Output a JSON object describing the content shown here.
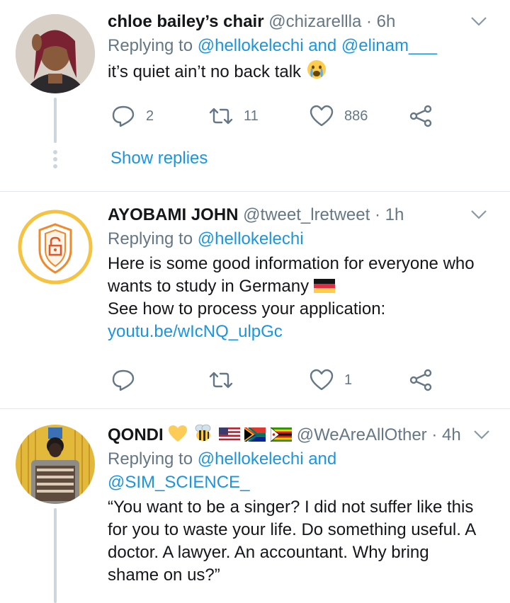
{
  "tweets": [
    {
      "name": "chloe bailey’s chair",
      "handle": "@chizarellla",
      "sep": "·",
      "time": "6h",
      "replying_prefix": "Replying to ",
      "replying_users_1": "@hellokelechi and @elinam___",
      "text_1": "it’s quiet ain’t no back talk",
      "counts": {
        "replies": "2",
        "retweets": "11",
        "likes": "886"
      },
      "show_replies": "Show replies"
    },
    {
      "name": "AYOBAMI JOHN",
      "handle": "@tweet_lretweet",
      "sep": "·",
      "time": "1h",
      "replying_prefix": "Replying to ",
      "replying_users_1": "@hellokelechi",
      "text_1": "Here is some good information for everyone who",
      "text_2": "wants to study in Germany",
      "text_3": "See how to process your application:",
      "link": "youtu.be/wIcNQ_ulpGc",
      "counts": {
        "replies": "",
        "retweets": "",
        "likes": "1"
      }
    },
    {
      "name": "QONDI",
      "handle": "@WeAreAllOther",
      "sep": "·",
      "time": "4h",
      "replying_prefix": "Replying to ",
      "replying_users_1": "@hellokelechi and",
      "replying_users_2": "@SIM_SCIENCE_",
      "text_1": "“You want to be a singer? I did not suffer like this",
      "text_2": "for you to waste your life. Do something useful. A",
      "text_3": "doctor. A lawyer. An accountant. Why bring",
      "text_4": "shame on us?”"
    }
  ],
  "icons": {
    "reply": "reply-icon",
    "retweet": "retweet-icon",
    "like": "heart-icon",
    "share": "share-icon",
    "more": "chevron-down-icon"
  },
  "colors": {
    "link": "#1b95e0",
    "muted": "#657786",
    "line": "#ccd6dd"
  }
}
